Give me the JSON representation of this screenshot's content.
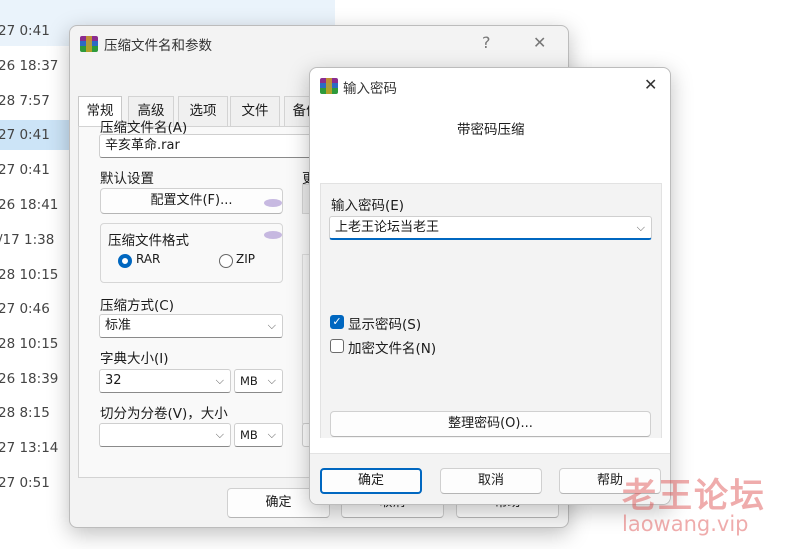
{
  "bg_list": {
    "rows": [
      {
        "time": "27 0:41",
        "name": ""
      },
      {
        "time": "26 18:37",
        "name": ""
      },
      {
        "time": "28 7:57",
        "name": ""
      },
      {
        "time": "27 0:41",
        "name": ""
      },
      {
        "time": "27 0:41",
        "name": ""
      },
      {
        "time": "26 18:41",
        "name": ""
      },
      {
        "time": "/17 1:38",
        "name": ""
      },
      {
        "time": "28 10:15",
        "name": ""
      },
      {
        "time": "27 0:46",
        "name": ""
      },
      {
        "time": "28 10:15",
        "name": ""
      },
      {
        "time": "26 18:39",
        "name": ""
      },
      {
        "time": "28 8:15",
        "name": ""
      },
      {
        "time": "27 13:14",
        "name": ""
      },
      {
        "time": "27 0:51",
        "name": ""
      }
    ]
  },
  "archive_dialog": {
    "title": "压缩文件名和参数",
    "help_btn": "?",
    "close_btn": "✕",
    "tabs": [
      "常规",
      "高级",
      "选项",
      "文件",
      "备份"
    ],
    "archive_name_label": "压缩文件名(A)",
    "archive_name_value": "辛亥革命.rar",
    "default_settings_label": "默认设置",
    "profiles_button": "配置文件(F)...",
    "update_label": "更",
    "format_label": "压缩文件格式",
    "format_rar": "RAR",
    "format_zip": "ZIP",
    "method_label": "压缩方式(C)",
    "method_value": "标准",
    "dict_label": "字典大小(I)",
    "dict_value": "32",
    "dict_unit": "MB",
    "split_label": "切分为分卷(V)，大小",
    "split_value": "",
    "split_unit": "MB",
    "ok_button": "确定",
    "cancel_button": "取消",
    "help_button": "帮助"
  },
  "password_dialog": {
    "title": "输入密码",
    "close_btn": "✕",
    "heading": "带密码压缩",
    "enter_label": "输入密码(E)",
    "password_value": "上老王论坛当老王",
    "show_password": "显示密码(S)",
    "show_password_checked": true,
    "encrypt_names": "加密文件名(N)",
    "encrypt_names_checked": false,
    "organize_button": "整理密码(O)...",
    "ok_button": "确定",
    "cancel_button": "取消",
    "help_button": "帮助"
  },
  "watermark": {
    "line1": "老王论坛",
    "line2": "laowang.vip"
  },
  "colors": {
    "accent": "#0067c0",
    "selection": "#cce4f7",
    "watermark": "#dc4646"
  }
}
